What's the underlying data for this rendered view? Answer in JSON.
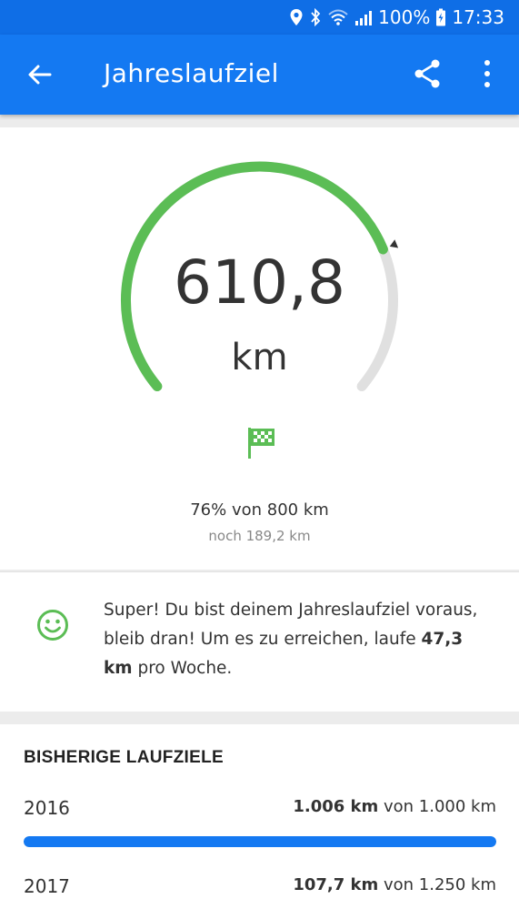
{
  "status_bar": {
    "battery": "100%",
    "time": "17:33",
    "icons": [
      "location-icon",
      "bluetooth-icon",
      "wifi-icon",
      "signal-icon",
      "battery-charging-icon"
    ]
  },
  "app_bar": {
    "title": "Jahreslaufziel",
    "icons": [
      "back-arrow-icon",
      "share-icon",
      "more-vert-icon"
    ]
  },
  "goal": {
    "distance": "610,8",
    "unit": "km",
    "progress_fraction": 0.76,
    "progress_text": "76% von 800 km",
    "remaining_text": "noch 189,2 km",
    "colors": {
      "progress": "#5bbd55",
      "track": "#e0e0e0",
      "marker": "#333333"
    }
  },
  "message": {
    "part1": "Super! Du bist deinem Jahreslaufziel voraus, bleib dran! Um es zu erreichen, laufe ",
    "bold": "47,3 km",
    "part2": " pro Woche."
  },
  "history": {
    "title": "BISHERIGE LAUFZIELE",
    "rows": [
      {
        "year": "2016",
        "done": "1.006 km",
        "of_text": " von 1.000 km",
        "fraction": 1.0
      },
      {
        "year": "2017",
        "done": "107,7 km",
        "of_text": " von 1.250 km",
        "fraction": 0.086
      }
    ]
  },
  "colors": {
    "primary": "#1479f2",
    "status_bar": "#0f6ee6",
    "success": "#5bbd55"
  }
}
